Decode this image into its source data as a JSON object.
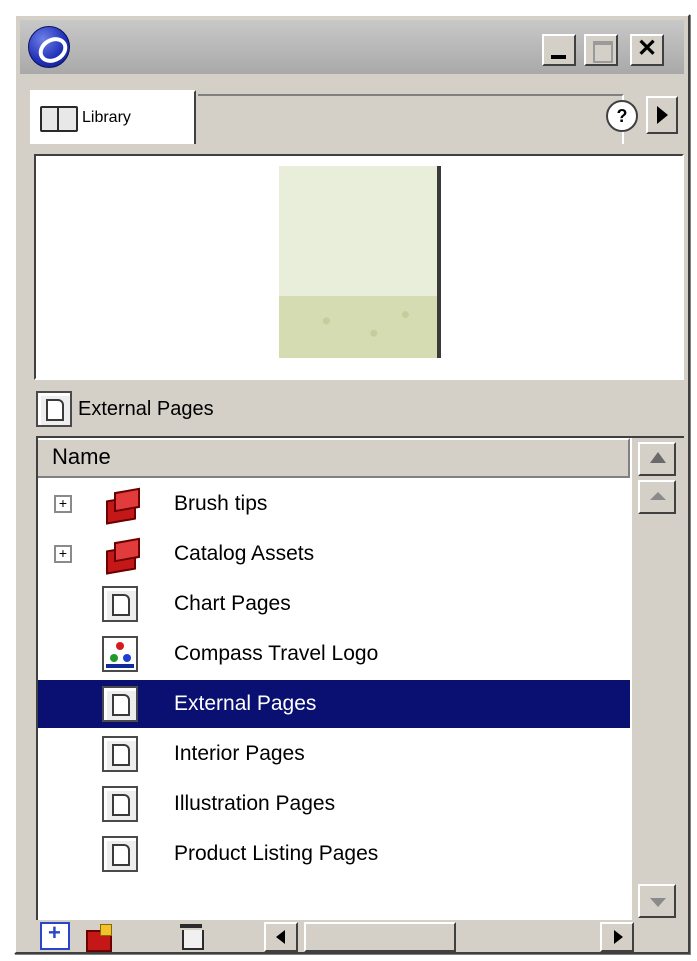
{
  "titlebar": {
    "minimize_icon": "minimize-icon",
    "maximize_icon": "maximize-icon",
    "close_label": "✕"
  },
  "tab": {
    "label": "Library",
    "help_label": "?"
  },
  "selected_item": {
    "label": "External Pages"
  },
  "list": {
    "column_header": "Name",
    "items": [
      {
        "label": "Brush tips",
        "type": "folder",
        "expandable": true
      },
      {
        "label": "Catalog Assets",
        "type": "folder",
        "expandable": true
      },
      {
        "label": "Chart Pages",
        "type": "page",
        "expandable": false
      },
      {
        "label": "Compass Travel Logo",
        "type": "graphic",
        "expandable": false
      },
      {
        "label": "External Pages",
        "type": "page",
        "expandable": false,
        "selected": true
      },
      {
        "label": "Interior Pages",
        "type": "page",
        "expandable": false
      },
      {
        "label": "Illustration Pages",
        "type": "page",
        "expandable": false
      },
      {
        "label": "Product Listing Pages",
        "type": "page",
        "expandable": false
      }
    ],
    "expander_symbol": "+"
  },
  "colors": {
    "selection": "#0a1072",
    "panel": "#d4d0c8"
  }
}
